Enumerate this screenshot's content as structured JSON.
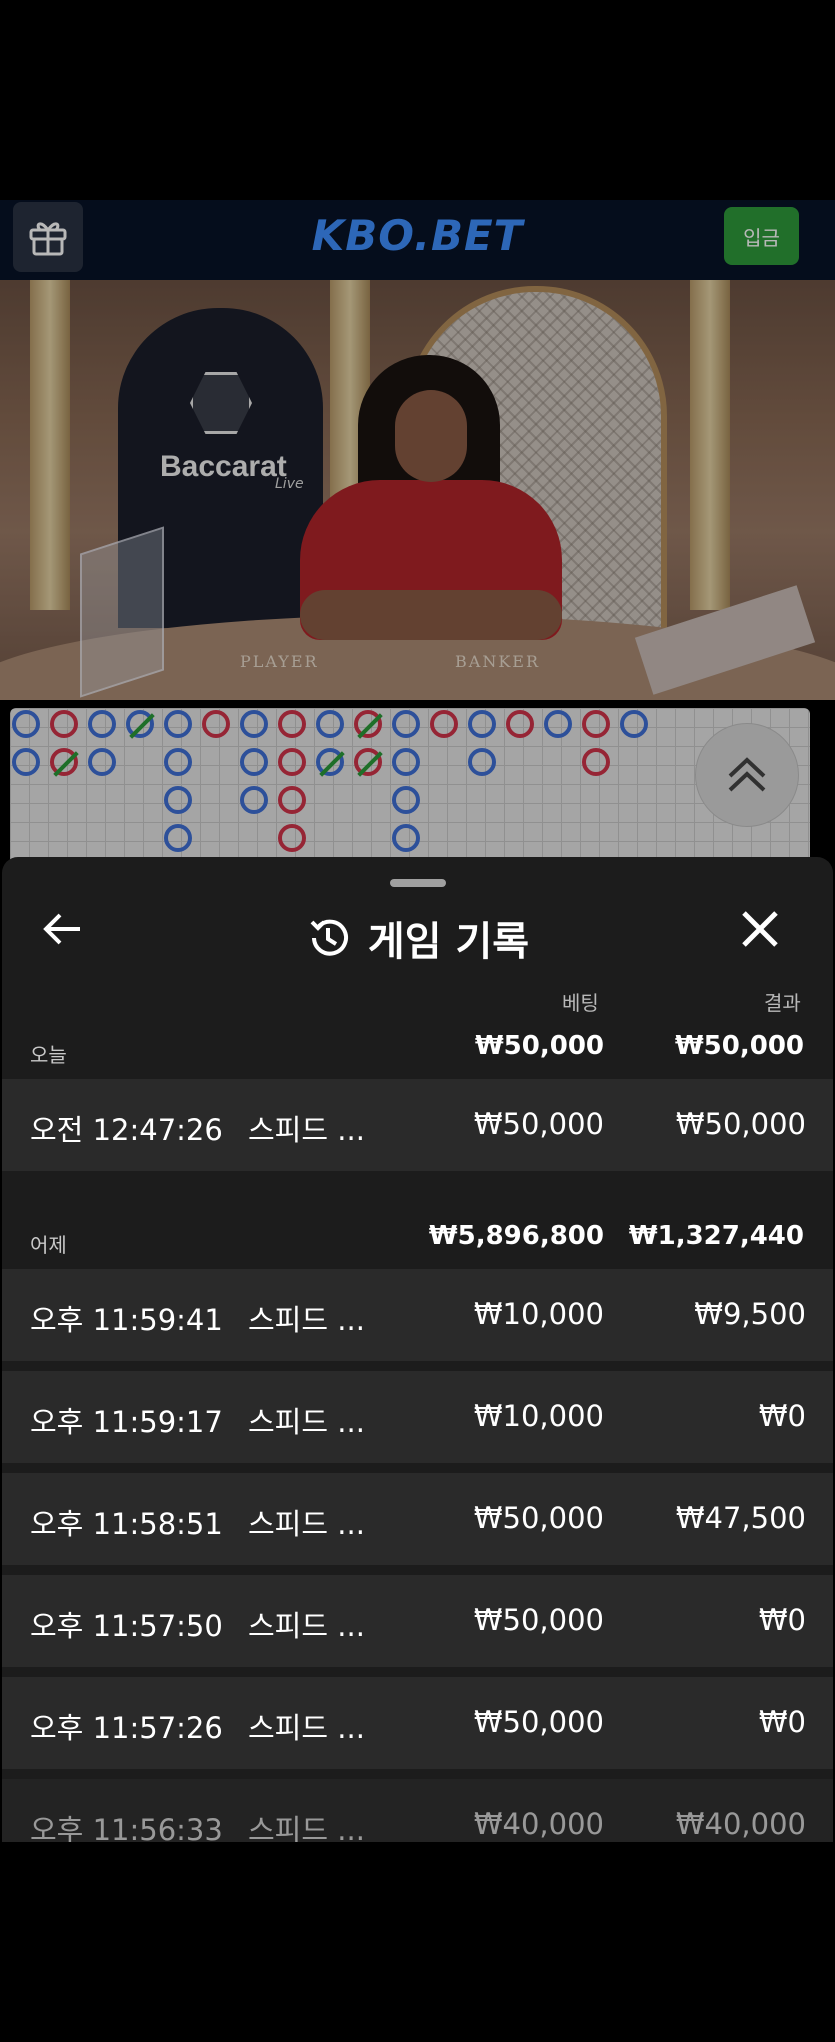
{
  "header": {
    "logo_main": "KBO",
    "logo_dot": ".",
    "logo_suffix": "BET",
    "deposit_label": "입금",
    "gift_icon": "gift-icon"
  },
  "video": {
    "brand": "Baccarat",
    "brand_sub": "Live",
    "player_label": "PLAYER",
    "banker_label": "BANKER"
  },
  "scoreboard": {
    "colors": {
      "player": "#3f6fd6",
      "banker": "#d0344a",
      "tie": "#2a9a3a"
    }
  },
  "sheet": {
    "title": "게임 기록",
    "history_icon": "history-icon",
    "columns": {
      "bet": "베팅",
      "result": "결과"
    },
    "groups": [
      {
        "label": "오늘",
        "bet_total": "₩50,000",
        "result_total": "₩50,000",
        "rows": [
          {
            "time": "오전 12:47:26",
            "game": "스피드 ...",
            "bet": "₩50,000",
            "result": "₩50,000"
          }
        ]
      },
      {
        "label": "어제",
        "bet_total": "₩5,896,800",
        "result_total": "₩1,327,440",
        "rows": [
          {
            "time": "오후 11:59:41",
            "game": "스피드 ...",
            "bet": "₩10,000",
            "result": "₩9,500"
          },
          {
            "time": "오후 11:59:17",
            "game": "스피드 ...",
            "bet": "₩10,000",
            "result": "₩0"
          },
          {
            "time": "오후 11:58:51",
            "game": "스피드 ...",
            "bet": "₩50,000",
            "result": "₩47,500"
          },
          {
            "time": "오후 11:57:50",
            "game": "스피드 ...",
            "bet": "₩50,000",
            "result": "₩0"
          },
          {
            "time": "오후 11:57:26",
            "game": "스피드 ...",
            "bet": "₩50,000",
            "result": "₩0"
          },
          {
            "time": "오후 11:56:33",
            "game": "스피드 ...",
            "bet": "₩40,000",
            "result": "₩40,000"
          }
        ]
      }
    ]
  }
}
